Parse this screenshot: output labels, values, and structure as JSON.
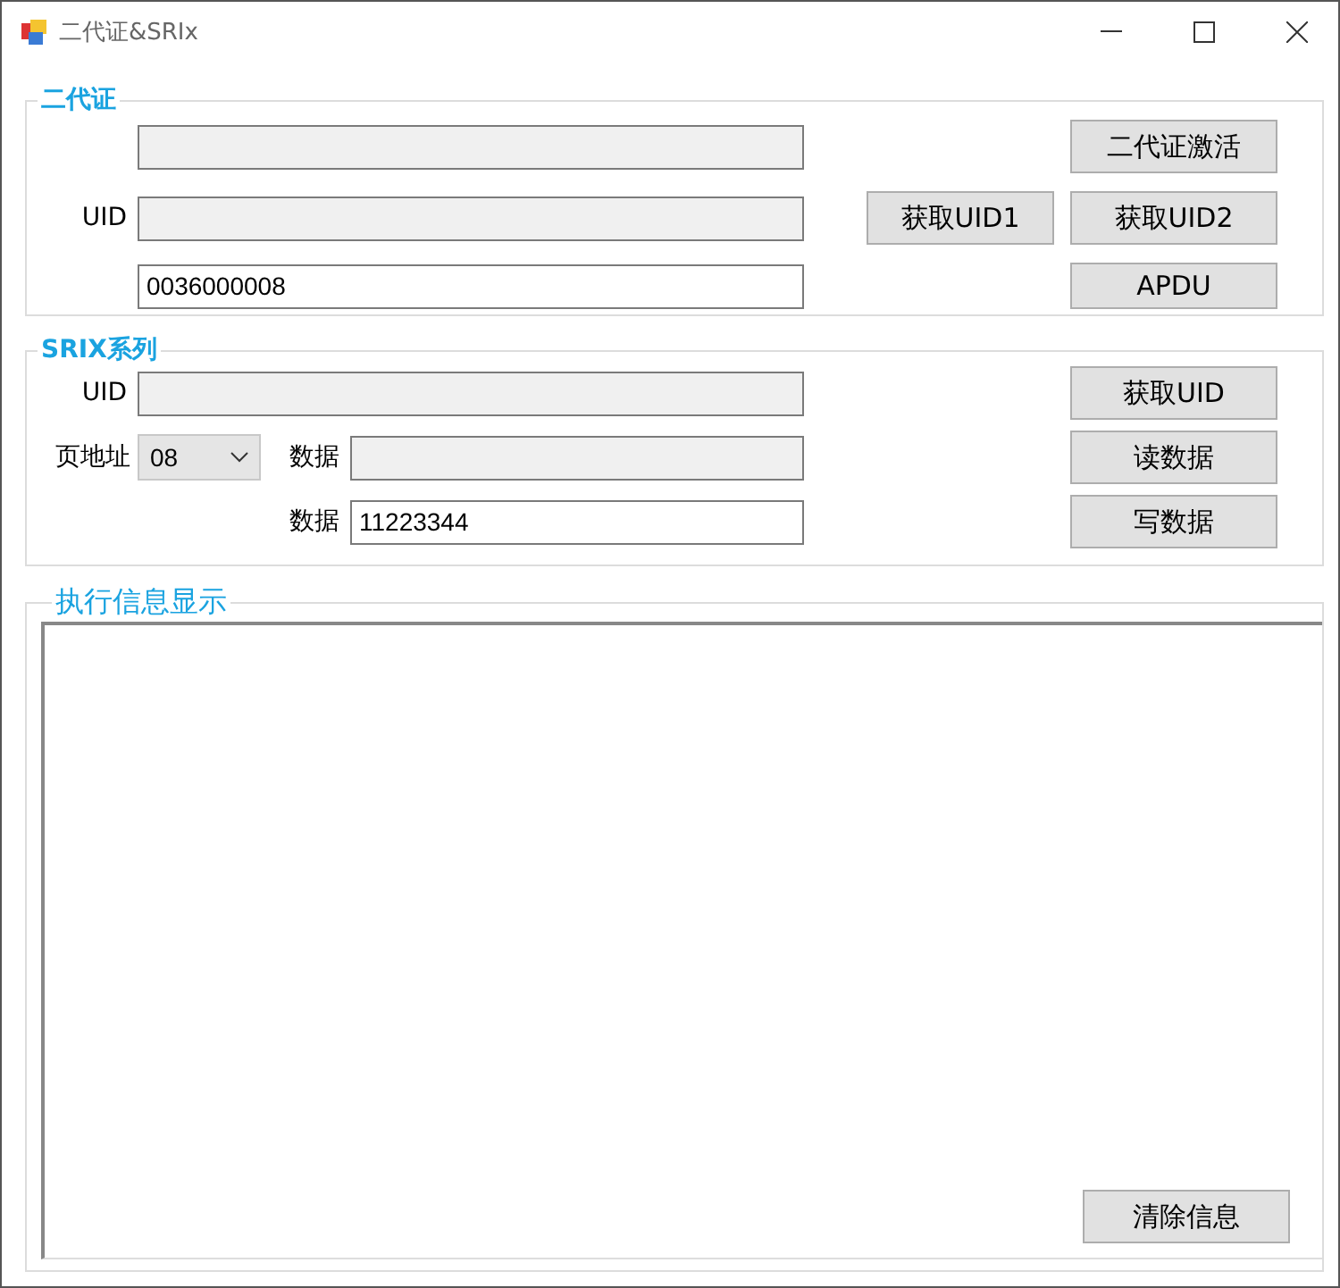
{
  "window": {
    "title": "二代证&SRIx"
  },
  "id_card": {
    "title": "二代证",
    "fields": [
      {
        "readonly": true
      },
      {
        "label": "UID",
        "readonly": true
      },
      {
        "value": "0036000008",
        "readonly": false
      }
    ],
    "uid1_button": "获取UID1",
    "buttons": [
      "二代证激活",
      "获取UID2",
      "APDU"
    ]
  },
  "srix": {
    "title": "SRIX系列",
    "uid": {
      "label": "UID",
      "readonly": true
    },
    "page_address": {
      "label": "页地址",
      "value": "08"
    },
    "read_data": {
      "label": "数据",
      "readonly": true
    },
    "write_data": {
      "label": "数据",
      "value": "11223344",
      "readonly": false
    },
    "buttons": [
      "获取UID",
      "读数据",
      "写数据"
    ]
  },
  "log": {
    "title": "执行信息显示",
    "clear_button": "清除信息"
  }
}
